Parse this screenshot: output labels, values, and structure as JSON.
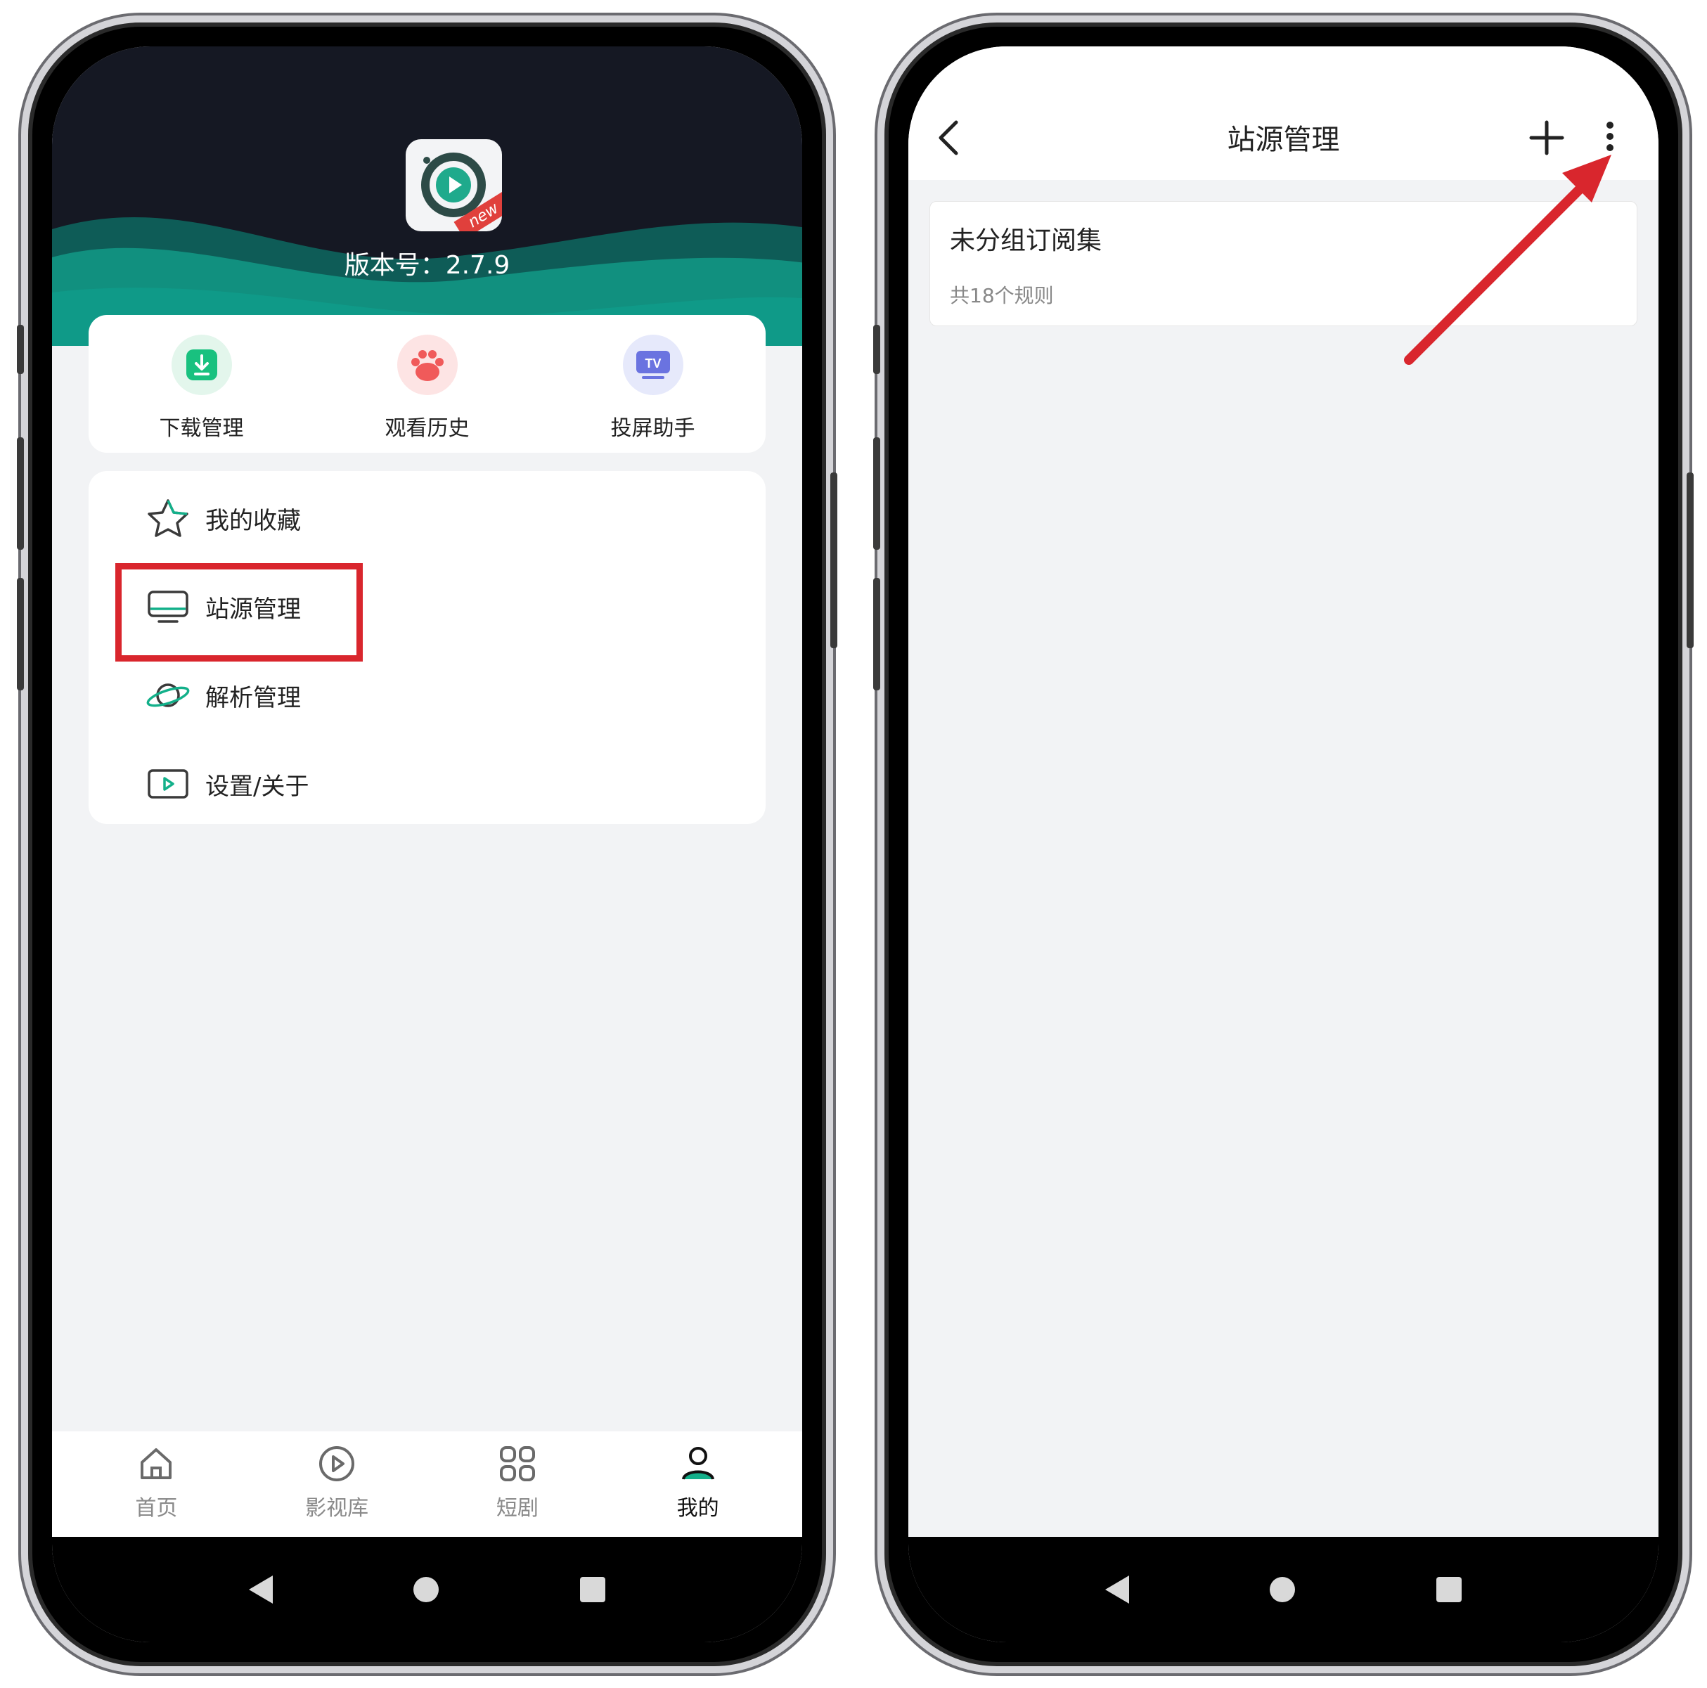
{
  "left_phone": {
    "version_text": "版本号：2.7.9",
    "logo_badge": "new",
    "quick_actions": [
      {
        "label": "下载管理",
        "icon": "download-icon"
      },
      {
        "label": "观看历史",
        "icon": "paw-icon"
      },
      {
        "label": "投屏助手",
        "icon": "tv-icon",
        "icon_text": "TV"
      }
    ],
    "menu": [
      {
        "label": "我的收藏",
        "icon": "star-icon"
      },
      {
        "label": "站源管理",
        "icon": "monitor-icon"
      },
      {
        "label": "解析管理",
        "icon": "planet-icon"
      },
      {
        "label": "设置/关于",
        "icon": "play-box-icon"
      }
    ],
    "tabs": [
      {
        "label": "首页",
        "icon": "home-icon"
      },
      {
        "label": "影视库",
        "icon": "play-circle-icon"
      },
      {
        "label": "短剧",
        "icon": "grid-icon"
      },
      {
        "label": "我的",
        "icon": "user-icon",
        "active": true
      }
    ]
  },
  "right_phone": {
    "title": "站源管理",
    "group": {
      "title": "未分组订阅集",
      "subtitle": "共18个规则"
    }
  },
  "colors": {
    "accent": "#13b08a",
    "highlight": "#d9262d",
    "hero_bg": "#151823",
    "teal_wave": "#0f8f80"
  }
}
